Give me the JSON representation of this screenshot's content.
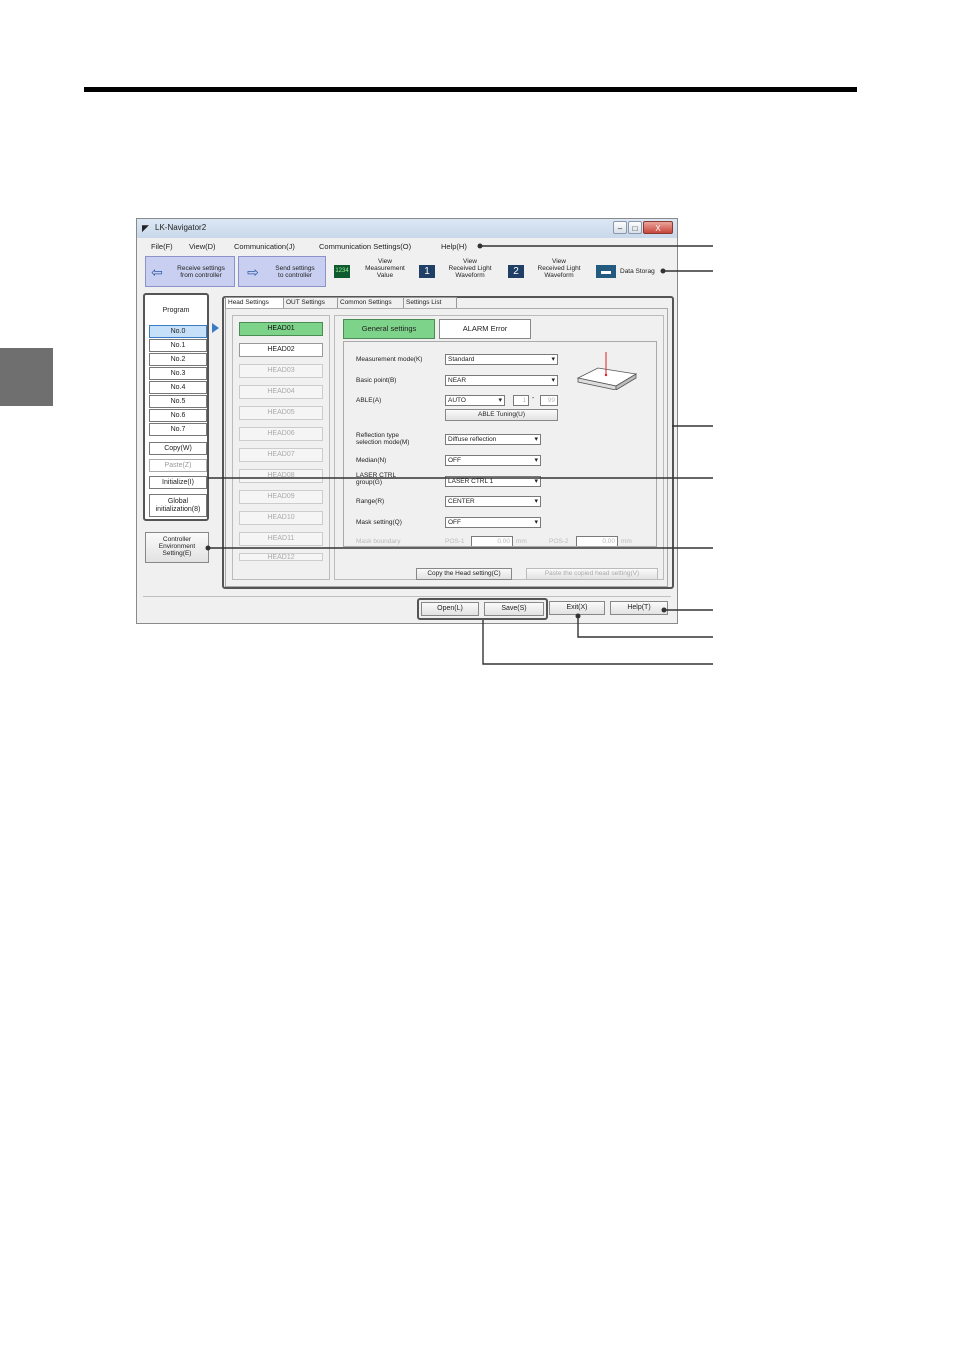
{
  "window": {
    "title": "LK-Navigator2",
    "controls": {
      "minimize": "–",
      "maximize": "□",
      "close": "X"
    }
  },
  "menu": [
    "File(F)",
    "View(D)",
    "Communication(J)",
    "Communication Settings(O)",
    "Help(H)"
  ],
  "toolbar": {
    "receive": [
      "Receive settings",
      "from controller"
    ],
    "send": [
      "Send settings",
      "to controller"
    ],
    "view_measurement": {
      "icon": "1234",
      "lines": [
        "View",
        "Measurement",
        "Value"
      ]
    },
    "view_waveform_1": {
      "icon": "1",
      "lines": [
        "View",
        "Received Light",
        "Waveform"
      ]
    },
    "view_waveform_2": {
      "icon": "2",
      "lines": [
        "View",
        "Received Light",
        "Waveform"
      ]
    },
    "data_storage": {
      "label": "Data Storag"
    }
  },
  "program": {
    "title": "Program",
    "items": [
      "No.0",
      "No.1",
      "No.2",
      "No.3",
      "No.4",
      "No.5",
      "No.6",
      "No.7"
    ],
    "selected": "No.0",
    "copy": "Copy(W)",
    "paste": "Paste(Z)",
    "initialize": "Initialize(I)",
    "global_init": [
      "Global",
      "initialization(8)"
    ]
  },
  "env_button": [
    "Controller",
    "Environment",
    "Setting(E)"
  ],
  "tabs": [
    "Head Settings",
    "OUT Settings",
    "Common Settings",
    "Settings List"
  ],
  "heads": [
    "HEAD01",
    "HEAD02",
    "HEAD03",
    "HEAD04",
    "HEAD05",
    "HEAD06",
    "HEAD07",
    "HEAD08",
    "HEAD09",
    "HEAD10",
    "HEAD11",
    "HEAD12"
  ],
  "subtabs": {
    "general": "General settings",
    "alarm": "ALARM Error"
  },
  "form": {
    "measurement_mode": {
      "label": "Measurement mode(K)",
      "value": "Standard"
    },
    "basic_point": {
      "label": "Basic point(B)",
      "value": "NEAR"
    },
    "able": {
      "label": "ABLE(A)",
      "value": "AUTO",
      "min": "1",
      "dash": "-",
      "max": "99",
      "tuning": "ABLE Tuning(U)"
    },
    "reflection": {
      "label": [
        "Reflection type",
        "selection mode(M)"
      ],
      "value": "Diffuse reflection"
    },
    "median": {
      "label": "Median(N)",
      "value": "OFF"
    },
    "laser_ctrl": {
      "label": [
        "LASER CTRL",
        "group(G)"
      ],
      "value": "LASER CTRL 1"
    },
    "range": {
      "label": "Range(R)",
      "value": "CENTER"
    },
    "mask": {
      "label": "Mask setting(Q)",
      "value": "OFF"
    },
    "mask_boundary": {
      "label": "Mask boundary",
      "pos1_label": "POS-1",
      "pos1_value": "0.00",
      "pos2_label": "POS-2",
      "pos2_value": "0.00",
      "unit": "mm"
    }
  },
  "copy_head": "Copy the Head setting(C)",
  "paste_head": "Paste the copied head setting(V)",
  "bottom": {
    "open": "Open(L)",
    "save": "Save(S)",
    "exit": "Exit(X)",
    "help": "Help(T)"
  },
  "colors": {
    "selected_green": "#7ed38a",
    "toolbar_blue": "#c9cff0",
    "selected_item": "#c5e0f8",
    "marker": "#3b7dc4"
  }
}
